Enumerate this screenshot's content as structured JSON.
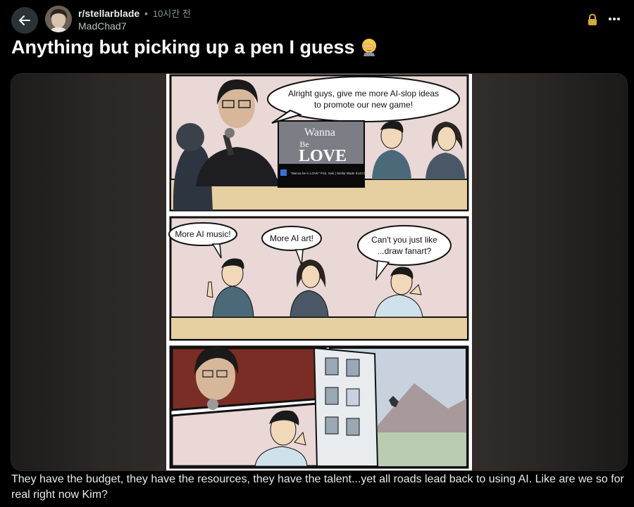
{
  "post": {
    "subreddit": "r/stellarblade",
    "separator": "•",
    "time_ago": "10시간 전",
    "username": "MadChad7",
    "title": "Anything but picking up a pen I guess",
    "body": "They have the budget, they have the resources, they have the talent...yet all roads lead back to using AI. Like are we so for real right now Kim?"
  },
  "comic": {
    "panel1_bubble": "Alright guys, give me more AI-slop ideas to promote our new game!",
    "panel1_bubble_l1": "Alright guys, give me more AI-slop ideas",
    "panel1_bubble_l2": "to promote our new game!",
    "thumbnail_title_l1": "Wanna",
    "thumbnail_title_l2": "Be",
    "thumbnail_title_l3": "LOVE",
    "thumbnail_caption": "\"Wanna be in LOVE\" Pick, Swk | Stellar Blade ELECCRAFF",
    "panel2_bubble_1": "More AI music!",
    "panel2_bubble_2": "More AI art!",
    "panel2_bubble_3_l1": "Can't you just like",
    "panel2_bubble_3_l2": "...draw fanart?"
  },
  "icons": {
    "back": "arrow-left-icon",
    "lock": "lock-icon",
    "more": "more-horizontal-icon",
    "title_emoji": "facepalm-emoji"
  },
  "colors": {
    "background": "#000000",
    "lock": "#d7a93b",
    "panel_wall": "#ead8d6",
    "table": "#e6cfa0"
  }
}
